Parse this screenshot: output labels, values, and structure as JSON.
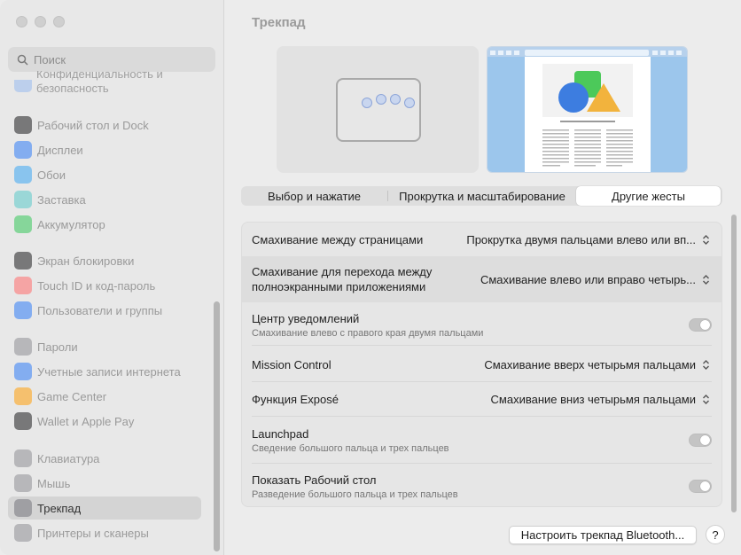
{
  "window": {
    "title": "Трекпад"
  },
  "search": {
    "placeholder": "Поиск"
  },
  "sidebar": {
    "wrapped_top": [
      "Конфиденциальность и",
      "безопасность"
    ],
    "items": [
      {
        "label": "Рабочий стол и Dock",
        "icon": "dock-icon",
        "color": "#1c1c1e"
      },
      {
        "label": "Дисплеи",
        "icon": "display-icon",
        "color": "#2f7cf6"
      },
      {
        "label": "Обои",
        "icon": "wallpaper-icon",
        "color": "#3aa5f2"
      },
      {
        "label": "Заставка",
        "icon": "screensaver-icon",
        "color": "#5ac8c8"
      },
      {
        "label": "Аккумулятор",
        "icon": "battery-icon",
        "color": "#34c759"
      },
      {
        "label": "Экран блокировки",
        "icon": "lock-icon",
        "color": "#1c1c1e"
      },
      {
        "label": "Touch ID и код-пароль",
        "icon": "fingerprint-icon",
        "color": "#ff6b6b"
      },
      {
        "label": "Пользователи и группы",
        "icon": "users-icon",
        "color": "#2f7cf6"
      },
      {
        "label": "Пароли",
        "icon": "key-icon",
        "color": "#8e8e93"
      },
      {
        "label": "Учетные записи интернета",
        "icon": "at-icon",
        "color": "#2f7cf6"
      },
      {
        "label": "Game Center",
        "icon": "game-center-icon",
        "color": "#ff9f0a"
      },
      {
        "label": "Wallet и Apple Pay",
        "icon": "wallet-icon",
        "color": "#1c1c1e"
      },
      {
        "label": "Клавиатура",
        "icon": "keyboard-icon",
        "color": "#8e8e93"
      },
      {
        "label": "Мышь",
        "icon": "mouse-icon",
        "color": "#8e8e93"
      },
      {
        "label": "Трекпад",
        "icon": "trackpad-icon",
        "color": "#8e8e93",
        "selected": true
      },
      {
        "label": "Принтеры и сканеры",
        "icon": "printer-icon",
        "color": "#8e8e93"
      }
    ]
  },
  "tabs": [
    {
      "label": "Выбор и нажатие",
      "selected": false
    },
    {
      "label": "Прокрутка и масштабирование",
      "selected": false
    },
    {
      "label": "Другие жесты",
      "selected": true
    }
  ],
  "settings": [
    {
      "label": "Смахивание между страницами",
      "control": "popup",
      "value": "Прокрутка двумя пальцами влево или вп..."
    },
    {
      "label": "Смахивание для перехода между полноэкранными приложениями",
      "control": "popup",
      "value": "Смахивание влево или вправо четырь..."
    },
    {
      "label": "Центр уведомлений",
      "sub": "Смахивание влево с правого края двумя пальцами",
      "control": "toggle",
      "on": true
    },
    {
      "label": "Mission Control",
      "control": "popup",
      "value": "Смахивание вверх четырьмя пальцами"
    },
    {
      "label": "Функция Exposé",
      "control": "popup",
      "value": "Смахивание вниз четырьмя пальцами"
    },
    {
      "label": "Launchpad",
      "sub": "Сведение большого пальца и трех пальцев",
      "control": "toggle",
      "on": true
    },
    {
      "label": "Показать Рабочий стол",
      "sub": "Разведение большого пальца и трех пальцев",
      "control": "toggle",
      "on": true
    }
  ],
  "buttons": {
    "bluetooth": "Настроить трекпад Bluetooth...",
    "help": "?"
  }
}
